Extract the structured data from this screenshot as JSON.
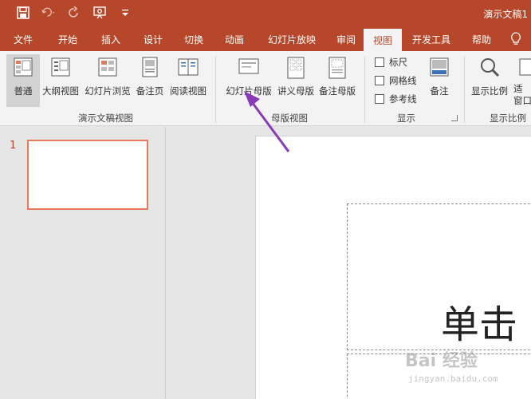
{
  "titlebar": {
    "doc_title": "演示文稿1",
    "icons": [
      "save-icon",
      "undo-icon",
      "redo-icon",
      "present-icon",
      "customize-icon"
    ]
  },
  "tabs": [
    {
      "label": "文件"
    },
    {
      "label": "开始"
    },
    {
      "label": "插入"
    },
    {
      "label": "设计"
    },
    {
      "label": "切换"
    },
    {
      "label": "动画"
    },
    {
      "label": "幻灯片放映"
    },
    {
      "label": "审阅"
    },
    {
      "label": "视图"
    },
    {
      "label": "开发工具"
    },
    {
      "label": "帮助"
    }
  ],
  "active_tab": "视图",
  "ribbon": {
    "presentation_views": {
      "group_label": "演示文稿视图",
      "normal": "普通",
      "outline": "大纲视图",
      "sorter": "幻灯片浏览",
      "notes_page": "备注页",
      "reading": "阅读视图"
    },
    "master_views": {
      "group_label": "母版视图",
      "slide_master": "幻灯片母版",
      "handout_master": "讲义母版",
      "notes_master": "备注母版"
    },
    "show": {
      "group_label": "显示",
      "ruler": "标尺",
      "gridlines": "网格线",
      "guides": "参考线",
      "notes": "备注"
    },
    "zoom": {
      "group_label": "显示比例",
      "zoom_btn": "显示比例",
      "fit_line1": "适",
      "fit_line2": "窗口"
    }
  },
  "thumbnails": {
    "slide_number": "1"
  },
  "slide": {
    "title_text": "单击"
  },
  "watermark": {
    "text": "Bai 经验",
    "sub": "jingyan.baidu.com"
  },
  "colors": {
    "accent": "#b7472a",
    "annotation_arrow": "#8a3ab9",
    "thumb_border": "#e8795a"
  }
}
